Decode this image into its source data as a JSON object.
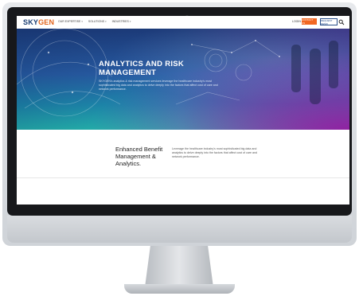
{
  "brand": {
    "logo_prefix": "SKY",
    "logo_accent": "GEN",
    "accent_color": "#f26722",
    "primary_color": "#1b3e73"
  },
  "nav": {
    "items": [
      {
        "label": "OUR EXPERTISE",
        "icon": "chevron-down-icon"
      },
      {
        "label": "SOLUTIONS",
        "icon": "chevron-down-icon"
      },
      {
        "label": "INDUSTRIES",
        "icon": "chevron-down-icon"
      }
    ],
    "login_label": "LOGIN",
    "contact_label": "CONTACT US",
    "demo_label": "REQUEST DEMO",
    "search_icon": "search-icon"
  },
  "hero": {
    "title": "ANALYTICS AND RISK MANAGEMENT",
    "text": "SKYGEN's analytics & risk management services leverage the healthcare industry's most sophisticated big data and analytics to delve deeply into the factors that affect cost of care and network performance."
  },
  "content": {
    "title": "Enhanced Benefit Management & Analytics.",
    "text": "Leverage the healthcare industry's most sophisticated big data and analytics to delve deeply into the factors that affect cost of care and network performance."
  }
}
